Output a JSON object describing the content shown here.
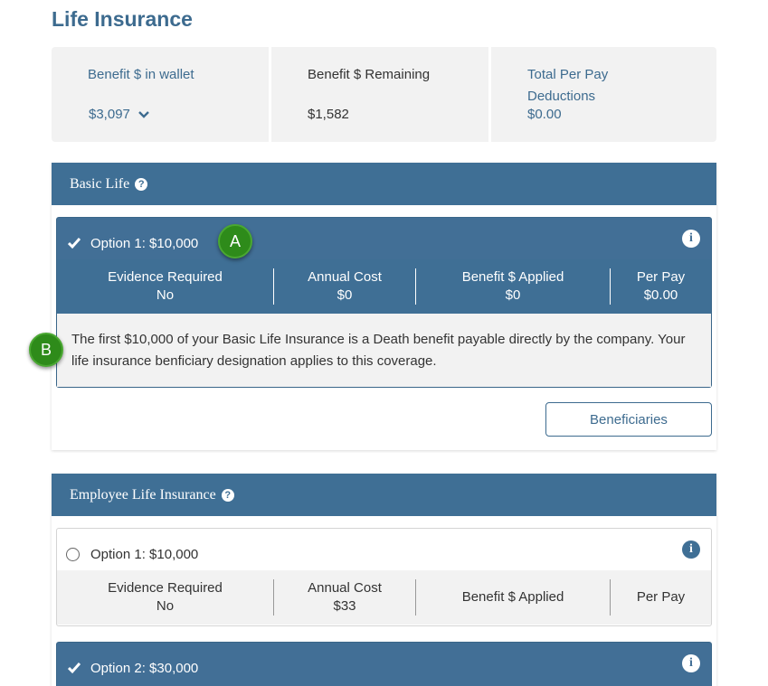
{
  "page": {
    "title": "Life Insurance"
  },
  "summary": {
    "wallet_label": "Benefit $ in wallet",
    "wallet_value": "$3,097",
    "remaining_label": "Benefit $ Remaining",
    "remaining_value": "$1,582",
    "deductions_label": "Total Per Pay Deductions",
    "deductions_value": "$0.00"
  },
  "sections": [
    {
      "title": "Basic Life",
      "options": [
        {
          "title": "Option 1: $10,000",
          "selected": true,
          "stats": [
            {
              "label": "Evidence Required",
              "value": "No"
            },
            {
              "label": "Annual Cost",
              "value": "$0"
            },
            {
              "label": "Benefit $ Applied",
              "value": "$0"
            },
            {
              "label": "Per Pay",
              "value": "$0.00"
            }
          ],
          "description": "The first $10,000 of your Basic Life Insurance is a Death benefit payable directly by the company. Your life insurance benficiary designation applies to this coverage."
        }
      ],
      "button_label": "Beneficiaries"
    },
    {
      "title": "Employee Life Insurance",
      "options": [
        {
          "title": "Option 1: $10,000",
          "selected": false,
          "stats": [
            {
              "label": "Evidence Required",
              "value": "No"
            },
            {
              "label": "Annual Cost",
              "value": "$33"
            },
            {
              "label": "Benefit $ Applied",
              "value": ""
            },
            {
              "label": "Per Pay",
              "value": ""
            }
          ]
        },
        {
          "title": "Option 2: $30,000",
          "selected": true
        }
      ]
    }
  ],
  "markers": {
    "a": "A",
    "b": "B"
  },
  "icons": {
    "help": "question-circle-icon",
    "info": "info-circle-icon",
    "check": "checkmark-icon",
    "chevron": "chevron-down-icon"
  },
  "colors": {
    "brand": "#3d6b8f",
    "header_bg": "#3f6f95",
    "summary_bg": "#f2f2f2",
    "marker_green": "#2e8b1a"
  }
}
